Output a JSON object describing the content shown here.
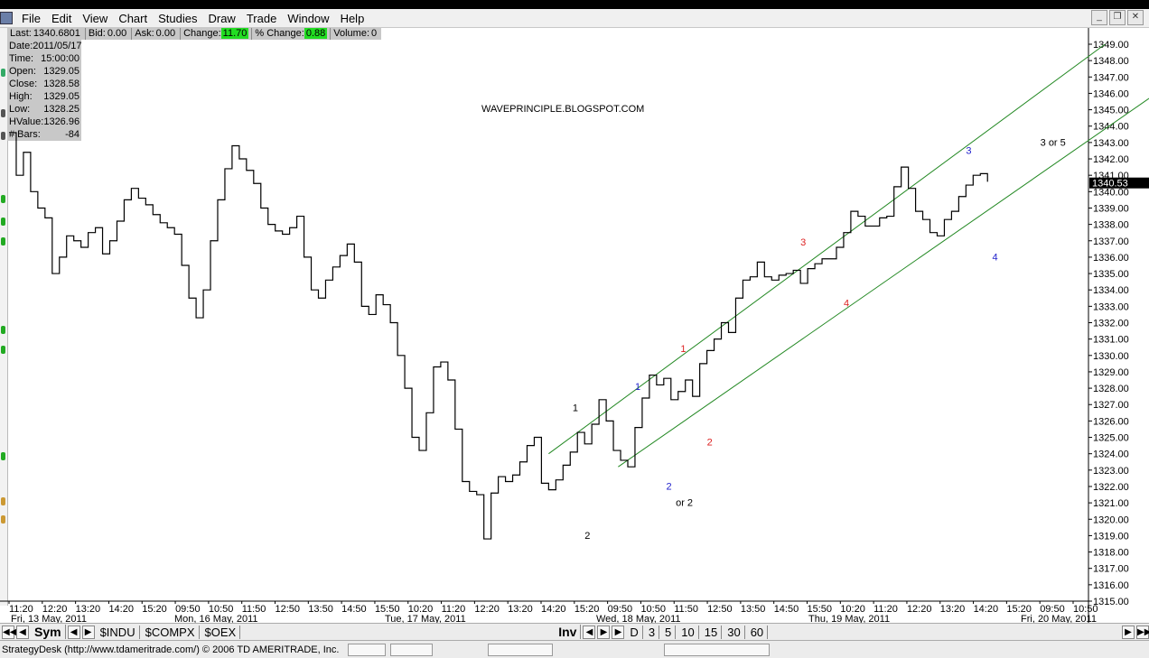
{
  "menu": [
    "File",
    "Edit",
    "View",
    "Chart",
    "Studies",
    "Draw",
    "Trade",
    "Window",
    "Help"
  ],
  "window_controls": [
    "_",
    "❐",
    "✕"
  ],
  "quote": [
    {
      "label": "Last:",
      "value": "1340.6801",
      "highlight": false
    },
    {
      "label": "Bid:",
      "value": "0.00",
      "highlight": false
    },
    {
      "label": "Ask:",
      "value": "0.00",
      "highlight": false
    },
    {
      "label": "Change:",
      "value": "11.70",
      "highlight": true
    },
    {
      "label": "% Change:",
      "value": "0.88",
      "highlight": true
    },
    {
      "label": "Volume:",
      "value": "0",
      "highlight": false
    }
  ],
  "databox": [
    {
      "label": "Date:",
      "value": "2011/05/17"
    },
    {
      "label": "Time:",
      "value": "15:00:00"
    },
    {
      "label": "Open:",
      "value": "1329.05"
    },
    {
      "label": "Close:",
      "value": "1328.58"
    },
    {
      "label": "High:",
      "value": "1329.05"
    },
    {
      "label": "Low:",
      "value": "1328.25"
    },
    {
      "label": "HValue:",
      "value": "1326.96"
    },
    {
      "label": "# Bars:",
      "value": "-84"
    }
  ],
  "colors": {
    "up": "#22dd22",
    "channel": "#228822",
    "wave_red": "#dd2222",
    "wave_blue": "#2222cc",
    "wave_black": "#000000"
  },
  "chart_data": {
    "type": "line",
    "title": "WAVEPRINCIPLE.BLOGSPOT.COM",
    "y_ticks": [
      "1349.00",
      "1348.00",
      "1347.00",
      "1346.00",
      "1345.00",
      "1344.00",
      "1343.00",
      "1342.00",
      "1341.00",
      "1340.00",
      "1339.00",
      "1338.00",
      "1337.00",
      "1336.00",
      "1335.00",
      "1334.00",
      "1333.00",
      "1332.00",
      "1331.00",
      "1330.00",
      "1329.00",
      "1328.00",
      "1327.00",
      "1326.00",
      "1325.00",
      "1324.00",
      "1323.00",
      "1322.00",
      "1321.00",
      "1320.00",
      "1319.00",
      "1318.00",
      "1317.00",
      "1316.00",
      "1315.00"
    ],
    "ylim": [
      1315,
      1349
    ],
    "current_price_label": "1340.53",
    "x_ticks": [
      "11:20",
      "12:20",
      "13:20",
      "14:20",
      "15:20",
      "09:50",
      "10:50",
      "11:50",
      "12:50",
      "13:50",
      "14:50",
      "15:50",
      "10:20",
      "11:20",
      "12:20",
      "13:20",
      "14:20",
      "15:20",
      "09:50",
      "10:50",
      "11:50",
      "12:50",
      "13:50",
      "14:50",
      "15:50",
      "10:20",
      "11:20",
      "12:20",
      "13:20",
      "14:20",
      "15:20",
      "09:50",
      "10:50"
    ],
    "date_labels": [
      "Fri, 13 May, 2011",
      "Mon, 16 May, 2011",
      "Tue, 17 May, 2011",
      "Wed, 18 May, 2011",
      "Thu, 19 May, 2011",
      "Fri, 20 May, 2011"
    ],
    "price_path": [
      [
        0,
        1343.6
      ],
      [
        3,
        1341.0
      ],
      [
        6,
        1342.4
      ],
      [
        9,
        1340.0
      ],
      [
        12,
        1339.0
      ],
      [
        15,
        1338.4
      ],
      [
        18,
        1335.0
      ],
      [
        21,
        1336.0
      ],
      [
        24,
        1337.3
      ],
      [
        27,
        1337.0
      ],
      [
        30,
        1336.6
      ],
      [
        33,
        1337.5
      ],
      [
        36,
        1337.8
      ],
      [
        39,
        1336.2
      ],
      [
        42,
        1337.0
      ],
      [
        45,
        1338.2
      ],
      [
        48,
        1339.5
      ],
      [
        51,
        1340.2
      ],
      [
        54,
        1339.6
      ],
      [
        57,
        1339.2
      ],
      [
        60,
        1338.6
      ],
      [
        63,
        1338.1
      ],
      [
        66,
        1337.8
      ],
      [
        69,
        1337.4
      ],
      [
        72,
        1335.5
      ],
      [
        75,
        1333.5
      ],
      [
        78,
        1332.3
      ],
      [
        81,
        1334.0
      ],
      [
        84,
        1337.0
      ],
      [
        87,
        1339.5
      ],
      [
        90,
        1341.4
      ],
      [
        93,
        1342.8
      ],
      [
        96,
        1342.0
      ],
      [
        99,
        1341.3
      ],
      [
        102,
        1340.5
      ],
      [
        105,
        1339.0
      ],
      [
        108,
        1338.0
      ],
      [
        111,
        1337.6
      ],
      [
        114,
        1337.4
      ],
      [
        117,
        1337.8
      ],
      [
        120,
        1338.5
      ],
      [
        123,
        1336.0
      ],
      [
        126,
        1334.0
      ],
      [
        129,
        1333.5
      ],
      [
        132,
        1334.6
      ],
      [
        135,
        1335.4
      ],
      [
        138,
        1336.1
      ],
      [
        141,
        1336.8
      ],
      [
        144,
        1335.7
      ],
      [
        147,
        1333.0
      ],
      [
        150,
        1332.5
      ],
      [
        153,
        1333.7
      ],
      [
        156,
        1333.1
      ],
      [
        159,
        1332.0
      ],
      [
        162,
        1330.0
      ],
      [
        165,
        1328.0
      ],
      [
        168,
        1325.0
      ],
      [
        171,
        1324.2
      ],
      [
        174,
        1326.5
      ],
      [
        177,
        1329.3
      ],
      [
        180,
        1329.6
      ],
      [
        183,
        1328.5
      ],
      [
        186,
        1325.5
      ],
      [
        189,
        1322.3
      ],
      [
        192,
        1321.7
      ],
      [
        195,
        1321.5
      ],
      [
        198,
        1318.8
      ],
      [
        201,
        1321.6
      ],
      [
        204,
        1322.6
      ],
      [
        207,
        1322.3
      ],
      [
        210,
        1322.7
      ],
      [
        213,
        1323.5
      ],
      [
        216,
        1324.5
      ],
      [
        219,
        1325.0
      ],
      [
        222,
        1322.2
      ],
      [
        225,
        1321.8
      ],
      [
        228,
        1322.4
      ],
      [
        231,
        1323.3
      ],
      [
        234,
        1324.1
      ],
      [
        237,
        1325.3
      ],
      [
        240,
        1324.6
      ],
      [
        243,
        1325.8
      ],
      [
        246,
        1327.3
      ],
      [
        249,
        1326.0
      ],
      [
        252,
        1324.2
      ],
      [
        255,
        1323.6
      ],
      [
        258,
        1323.2
      ],
      [
        261,
        1325.6
      ],
      [
        264,
        1327.4
      ],
      [
        267,
        1328.8
      ],
      [
        270,
        1328.2
      ],
      [
        273,
        1328.6
      ],
      [
        276,
        1327.3
      ],
      [
        279,
        1327.8
      ],
      [
        282,
        1328.5
      ],
      [
        285,
        1327.5
      ],
      [
        288,
        1329.5
      ],
      [
        291,
        1330.3
      ],
      [
        294,
        1331.0
      ],
      [
        297,
        1332.0
      ],
      [
        300,
        1331.4
      ],
      [
        303,
        1333.5
      ],
      [
        306,
        1334.6
      ],
      [
        309,
        1334.8
      ],
      [
        312,
        1335.7
      ],
      [
        315,
        1334.8
      ],
      [
        318,
        1334.6
      ],
      [
        321,
        1334.9
      ],
      [
        324,
        1335.0
      ],
      [
        327,
        1335.2
      ],
      [
        330,
        1334.4
      ],
      [
        333,
        1335.3
      ],
      [
        336,
        1335.6
      ],
      [
        339,
        1335.9
      ],
      [
        342,
        1335.9
      ],
      [
        345,
        1336.6
      ],
      [
        348,
        1337.5
      ],
      [
        351,
        1338.8
      ],
      [
        354,
        1338.5
      ],
      [
        357,
        1337.9
      ],
      [
        360,
        1337.9
      ],
      [
        363,
        1338.4
      ],
      [
        366,
        1338.5
      ],
      [
        369,
        1340.3
      ],
      [
        372,
        1341.5
      ],
      [
        375,
        1340.2
      ],
      [
        378,
        1338.8
      ],
      [
        381,
        1338.3
      ],
      [
        384,
        1337.5
      ],
      [
        387,
        1337.3
      ],
      [
        390,
        1338.3
      ],
      [
        393,
        1338.8
      ],
      [
        396,
        1339.7
      ],
      [
        399,
        1340.4
      ],
      [
        402,
        1341.0
      ],
      [
        405,
        1341.1
      ],
      [
        408,
        1340.6
      ]
    ],
    "channel_lines": [
      {
        "from": [
          225,
          1324.0
        ],
        "to": [
          457,
          1349.0
        ]
      },
      {
        "from": [
          254,
          1323.2
        ],
        "to": [
          502,
          1348.4
        ]
      }
    ],
    "wave_labels": [
      {
        "text": "1",
        "x": 235,
        "y": 1326.6,
        "color": "black"
      },
      {
        "text": "2",
        "x": 240,
        "y": 1318.8,
        "color": "black"
      },
      {
        "text": "1",
        "x": 261,
        "y": 1327.9,
        "color": "blue"
      },
      {
        "text": "2",
        "x": 274,
        "y": 1321.8,
        "color": "blue"
      },
      {
        "text": "or 2",
        "x": 278,
        "y": 1320.8,
        "color": "black"
      },
      {
        "text": "1",
        "x": 280,
        "y": 1330.2,
        "color": "red"
      },
      {
        "text": "2",
        "x": 291,
        "y": 1324.5,
        "color": "red"
      },
      {
        "text": "3",
        "x": 330,
        "y": 1336.7,
        "color": "red"
      },
      {
        "text": "4",
        "x": 348,
        "y": 1333.0,
        "color": "red"
      },
      {
        "text": "3",
        "x": 399,
        "y": 1342.3,
        "color": "blue"
      },
      {
        "text": "4",
        "x": 410,
        "y": 1335.8,
        "color": "blue"
      },
      {
        "text": "3 or 5",
        "x": 430,
        "y": 1342.8,
        "color": "black"
      }
    ]
  },
  "tabs_left": [
    "Sym",
    "$INDU",
    "$COMPX",
    "$OEX"
  ],
  "tabs_right": [
    "Inv",
    "D",
    "3",
    "5",
    "10",
    "15",
    "30",
    "60"
  ],
  "status_text": "StrategyDesk (http://www.tdameritrade.com/) © 2006 TD AMERITRADE, Inc."
}
